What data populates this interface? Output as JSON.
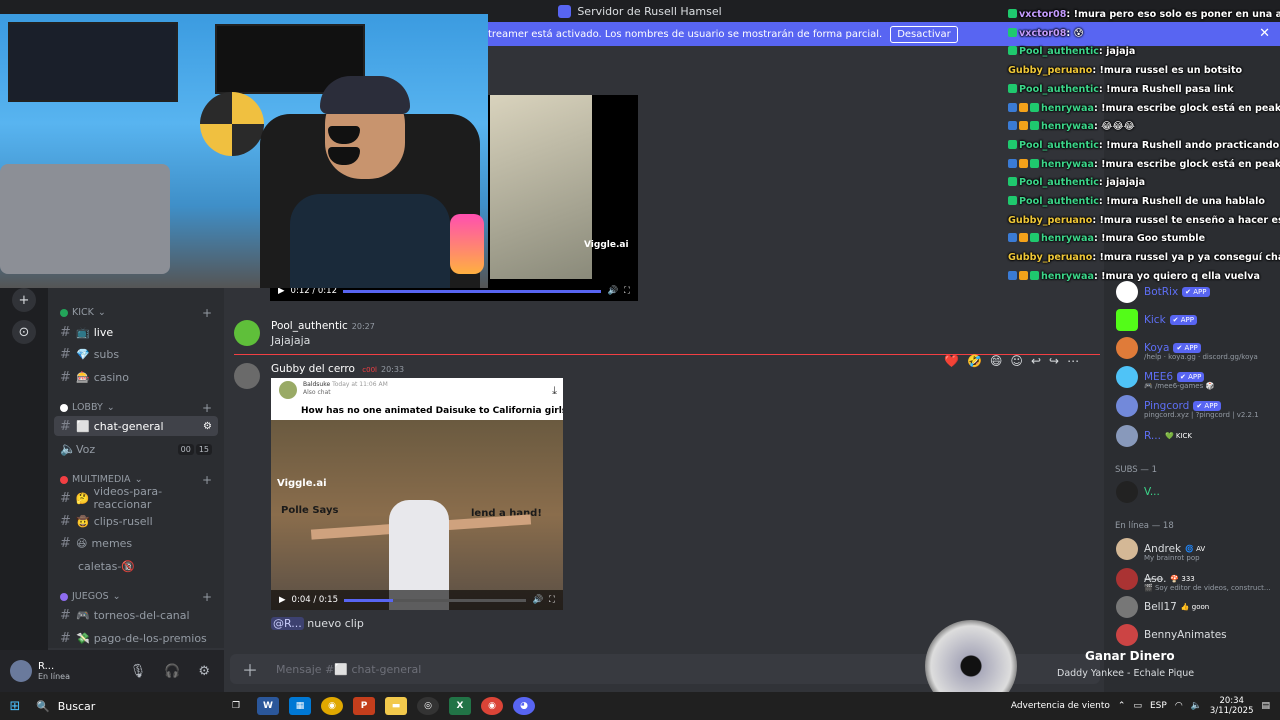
{
  "window": {
    "title": "Servidor de Rusell Hamsel"
  },
  "notice": {
    "text": "treamer está activado. Los nombres de usuario se mostrarán de forma parcial.",
    "button": "Desactivar"
  },
  "channels": {
    "categories": [
      {
        "name": "KICK",
        "color": "#23a55a"
      },
      {
        "name": "LOBBY",
        "color": "#ffffff"
      },
      {
        "name": "MULTIMEDIA",
        "color": "#f23f43"
      },
      {
        "name": "JUEGOS",
        "color": "#8e6cf0"
      }
    ],
    "items": [
      {
        "name": "live",
        "emoji": "📺"
      },
      {
        "name": "subs",
        "emoji": "💎"
      },
      {
        "name": "casino",
        "emoji": "🎰"
      },
      {
        "name": "chat-general",
        "emoji": "⬜"
      },
      {
        "name": "Voz",
        "emoji": "🔊",
        "badges": [
          "00",
          "15"
        ]
      },
      {
        "name": "videos-para-reaccionar",
        "emoji": "🤔"
      },
      {
        "name": "clips-rusell",
        "emoji": "🤠"
      },
      {
        "name": "memes",
        "emoji": "😆"
      },
      {
        "name": "caletas-",
        "emoji": "🔞"
      },
      {
        "name": "torneos-del-canal",
        "emoji": "🎮"
      },
      {
        "name": "pago-de-los-premios",
        "emoji": "💸"
      }
    ]
  },
  "user": {
    "name": "R...",
    "status": "En línea"
  },
  "video1": {
    "time": "0:12 / 0:12",
    "progress": 1.0,
    "watermark": "Viggle.ai"
  },
  "messages": [
    {
      "user": "Pool_authentic",
      "time": "20:27",
      "text": "Jajajaja"
    },
    {
      "user": "Gubby del cerro",
      "badge": "c00l",
      "time": "20:33"
    }
  ],
  "video2": {
    "account": "Baldsuke",
    "account_meta": "Today at 11:06 AM",
    "sub": "Also chat",
    "caption": "How has no one animated Daisuke to California girls",
    "sign1": "Polle Says",
    "sign2": "lend a hand!",
    "watermark": "Viggle.ai",
    "time": "0:04 / 0:15",
    "progress": 0.27
  },
  "reply": {
    "mention": "@R...",
    "text": "nuevo clip"
  },
  "composer": {
    "placeholder": "Mensaje #⬜ chat-general"
  },
  "members": {
    "bots": [
      {
        "name": "BotRix",
        "tag": "✔ APP",
        "color": "#ffffff"
      },
      {
        "name": "Kick",
        "tag": "✔ APP",
        "color": "#53fc18"
      },
      {
        "name": "Koya",
        "tag": "✔ APP",
        "sub": "/help · koya.gg · discord.gg/koya",
        "color": "#e07b39"
      },
      {
        "name": "MEE6",
        "tag": "✔ APP",
        "sub": "🎮 /meе6-games 🎲",
        "color": "#4fc3f7"
      },
      {
        "name": "Pingcord",
        "tag": "✔ APP",
        "sub": "pingcord.xyz | ?pingcord | v2.2.1",
        "color": "#7289da"
      },
      {
        "name": "R...",
        "tag": "💚 KICK",
        "color": "#8899bb"
      }
    ],
    "subs_header": "SUBS — 1",
    "subs": [
      {
        "name": "V...",
        "color": "#333333"
      }
    ],
    "online_header": "En línea — 18",
    "online": [
      {
        "name": "Andrek",
        "tag": "🌀 AV",
        "sub": "My brainrot pop",
        "color": "#d4b896"
      },
      {
        "name": "A̶s̶o̶.",
        "tag": "🍄 333",
        "sub": "🎬 Soy editor de videos, construct...",
        "color": "#a33"
      },
      {
        "name": "Bell17",
        "tag": "👍 goon",
        "color": "#777"
      },
      {
        "name": "BennyAnimates",
        "color": "#c44"
      }
    ]
  },
  "overlay_chat": [
    {
      "user": "vxctor08",
      "text": ": !mura pero eso solo es poner en una app",
      "cls": "p",
      "badges": [
        "b"
      ]
    },
    {
      "user": "vxctor08",
      "text": ": 😰",
      "cls": "p",
      "badges": [
        "b"
      ]
    },
    {
      "user": "Pool_authentic",
      "text": ": jajaja",
      "cls": "g",
      "badges": [
        "b"
      ]
    },
    {
      "user": "Gubby_peruano",
      "text": ": !mura russel es un botsito",
      "cls": "y",
      "badges": []
    },
    {
      "user": "Pool_authentic",
      "text": ": !mura Rushell pasa link",
      "cls": "g",
      "badges": [
        "b"
      ]
    },
    {
      "user": "henrywaa",
      "text": ": !mura escribe glock está en peak matenio",
      "cls": "g",
      "badges": [
        "b2",
        "b3",
        "b"
      ]
    },
    {
      "user": "henrywaa",
      "text": ": 😂😂😂",
      "cls": "g",
      "badges": [
        "b2",
        "b3",
        "b"
      ]
    },
    {
      "user": "Pool_authentic",
      "text": ": !mura Rushell ando practicando ya pa an",
      "cls": "g",
      "badges": [
        "b"
      ]
    },
    {
      "user": "henrywaa",
      "text": ": !mura escribe glock está en peak matenio",
      "cls": "g",
      "badges": [
        "b2",
        "b3",
        "b"
      ]
    },
    {
      "user": "Pool_authentic",
      "text": ": jajajaja",
      "cls": "g",
      "badges": [
        "b"
      ]
    },
    {
      "user": "Pool_authentic",
      "text": ": !mura Rushell de una hablalo",
      "cls": "g",
      "badges": [
        "b"
      ]
    },
    {
      "user": "Gubby_peruano",
      "text": ": !mura russel te enseño a hacer esos videos",
      "cls": "y",
      "badges": []
    },
    {
      "user": "henrywaa",
      "text": ": !mura Goo stumble",
      "cls": "g",
      "badges": [
        "b2",
        "b3",
        "b"
      ]
    },
    {
      "user": "Gubby_peruano",
      "text": ": !mura russel ya p ya conseguí chamba a m",
      "cls": "y",
      "badges": []
    },
    {
      "user": "henrywaa",
      "text": ": !mura yo quiero q ella vuelva",
      "cls": "g",
      "badges": [
        "b2",
        "b3",
        "b"
      ]
    }
  ],
  "now_playing": {
    "title": "Ganar Dinero",
    "artist": "Daddy Yankee - Echale Pique"
  },
  "taskbar": {
    "search": "Buscar",
    "weather": "Advertencia de viento",
    "lang": "ESP",
    "time": "20:34",
    "date": "3/11/2025"
  }
}
